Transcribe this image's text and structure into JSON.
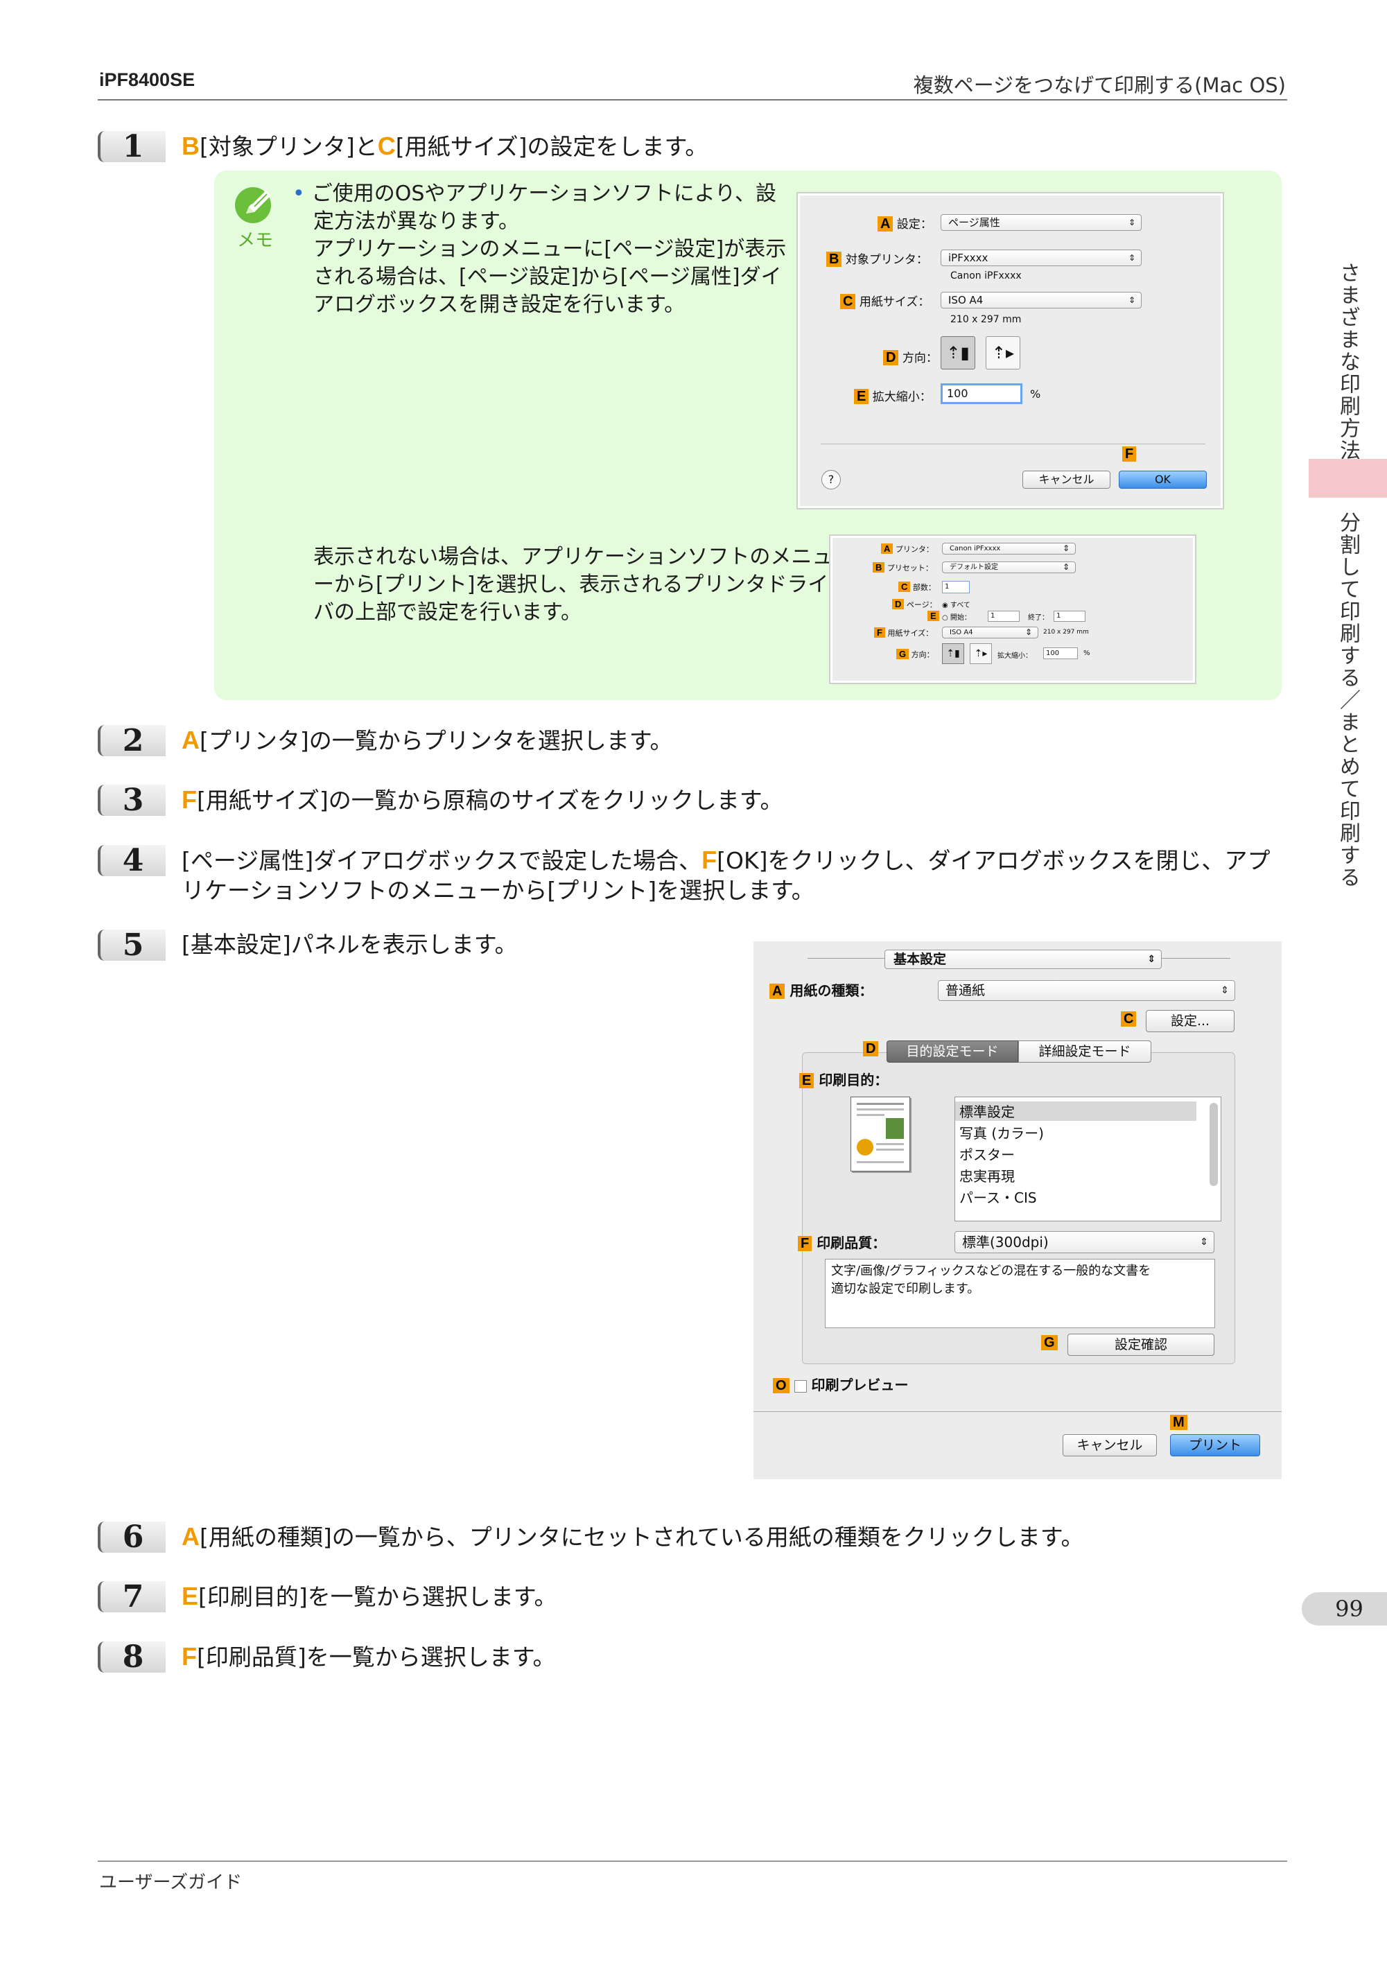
{
  "header": {
    "model": "iPF8400SE",
    "section": "複数ページをつなげて印刷する(Mac OS)"
  },
  "steps": {
    "s1": {
      "num": "1",
      "l1": "B",
      "t1": "[対象プリンタ]と",
      "l2": "C",
      "t2": "[用紙サイズ]の設定をします。"
    },
    "s2": {
      "num": "2",
      "l1": "A",
      "t1": "[プリンタ]の一覧からプリンタを選択します。"
    },
    "s3": {
      "num": "3",
      "l1": "F",
      "t1": "[用紙サイズ]の一覧から原稿のサイズをクリックします。"
    },
    "s4": {
      "num": "4",
      "t0": "[ページ属性]ダイアログボックスで設定した場合、",
      "l1": "F",
      "t1": "[OK]をクリックし、ダイアログボックスを閉じ、アプ",
      "t2": "リケーションソフトのメニューから[プリント]を選択します。"
    },
    "s5": {
      "num": "5",
      "t1": "[基本設定]パネルを表示します。"
    },
    "s6": {
      "num": "6",
      "l1": "A",
      "t1": "[用紙の種類]の一覧から、プリンタにセットされている用紙の種類をクリックします。"
    },
    "s7": {
      "num": "7",
      "l1": "E",
      "t1": "[印刷目的]を一覧から選択します。"
    },
    "s8": {
      "num": "8",
      "l1": "F",
      "t1": "[印刷品質]を一覧から選択します。"
    }
  },
  "memo": {
    "label": "メモ",
    "p1": [
      "ご使用のOSやアプリケーションソフトにより、設",
      "定方法が異なります。",
      "アプリケーションのメニューに[ページ設定]が表示",
      "される場合は、[ページ設定]から[ページ属性]ダイ",
      "アログボックスを開き設定を行います。"
    ],
    "p2": [
      "表示されない場合は、アプリケーションソフトのメニュ",
      "ーから[プリント]を選択し、表示されるプリンタドライ",
      "バの上部で設定を行います。"
    ]
  },
  "dialog1": {
    "letters": {
      "a": "A",
      "b": "B",
      "c": "C",
      "d": "D",
      "e": "E",
      "f": "F"
    },
    "settings_label": "設定：",
    "settings_value": "ページ属性",
    "printer_label": "対象プリンタ：",
    "printer_value": "iPFxxxx",
    "printer_sub": "Canon iPFxxxx",
    "paper_label": "用紙サイズ：",
    "paper_value": "ISO A4",
    "paper_sub": "210 x 297 mm",
    "orient_label": "方向：",
    "scale_label": "拡大縮小：",
    "scale_value": "100",
    "scale_unit": "%",
    "help": "?",
    "cancel": "キャンセル",
    "ok": "OK"
  },
  "dialog2": {
    "letters": {
      "a": "A",
      "b": "B",
      "c": "C",
      "d": "D",
      "e": "E",
      "f": "F",
      "g": "G"
    },
    "printer_label": "プリンタ：",
    "printer_value": "Canon iPFxxxx",
    "preset_label": "プリセット：",
    "preset_value": "デフォルト設定",
    "copies_label": "部数：",
    "copies_value": "1",
    "pages_label": "ページ：",
    "pages_all": "すべて",
    "pages_from": "開始：",
    "from_value": "1",
    "pages_to": "終了：",
    "to_value": "1",
    "paper_label": "用紙サイズ：",
    "paper_value": "ISO A4",
    "paper_sub": "210 x 297 mm",
    "orient_label": "方向：",
    "scale_label": "拡大縮小：",
    "scale_value": "100",
    "scale_unit": "%"
  },
  "dialog3": {
    "letters": {
      "a": "A",
      "c": "C",
      "d": "D",
      "e": "E",
      "f": "F",
      "g": "G",
      "o": "O",
      "m": "M"
    },
    "panel": "基本設定",
    "media_label": "用紙の種類：",
    "media_value": "普通紙",
    "settings_btn": "設定...",
    "tab_easy": "目的設定モード",
    "tab_adv": "詳細設定モード",
    "purpose_label": "印刷目的：",
    "purposes": [
      "標準設定",
      "写真 (カラー)",
      "ポスター",
      "忠実再現",
      "パース・CIS"
    ],
    "quality_label": "印刷品質：",
    "quality_value": "標準(300dpi)",
    "desc": [
      "文字/画像/グラフィックスなどの混在する一般的な文書を",
      "適切な設定で印刷します。"
    ],
    "confirm_btn": "設定確認",
    "preview_label": "印刷プレビュー",
    "cancel": "キャンセル",
    "print": "プリント"
  },
  "sidebar": {
    "tab1": "さまざまな印刷方法",
    "tab2": "分割して印刷する／まとめて印刷する"
  },
  "page_number": "99",
  "footer": "ユーザーズガイド"
}
